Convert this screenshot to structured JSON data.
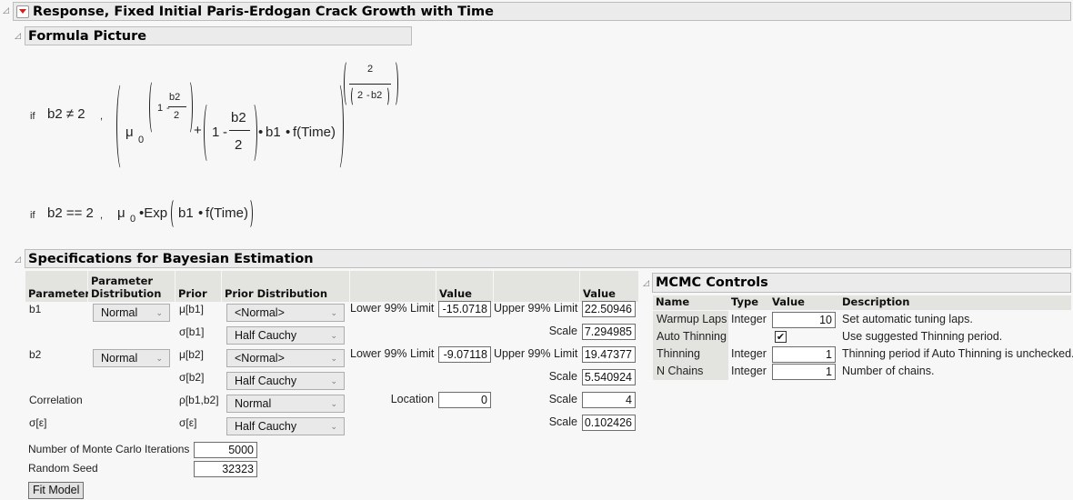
{
  "report": {
    "title": "Response, Fixed Initial Paris-Erdogan Crack Growth with Time",
    "menu_icon": "red-triangle-menu-icon",
    "disclosure_icon": "disclosure-triangle-icon"
  },
  "formula_picture": {
    "title": "Formula Picture",
    "case1": {
      "if": "if",
      "condition": "b2 ≠ 2",
      "comma": ",",
      "mu": "μ",
      "sub0": "0",
      "one": "1",
      "minus": "-",
      "b2": "b2",
      "two": "2",
      "plus": "+",
      "dot": "•",
      "b1": "b1",
      "f_time": "f(Time)",
      "exp_num": "2",
      "exp_den_a": "2",
      "exp_den_b": "b2"
    },
    "case2": {
      "if": "if",
      "condition": "b2 == 2",
      "comma": ",",
      "mu": "μ",
      "sub0": "0",
      "exp": "•Exp",
      "b1": "b1",
      "dot": "•",
      "f_time": "f(Time)"
    }
  },
  "specifications": {
    "title": "Specifications for Bayesian Estimation",
    "headers": {
      "parameter": "Parameter",
      "param_dist_1": "Parameter",
      "param_dist_2": "Distribution",
      "prior": "Prior",
      "prior_distribution": "Prior Distribution",
      "value1": "Value",
      "value2": "Value"
    },
    "rows": [
      {
        "parameter": "b1",
        "param_dist": "Normal",
        "prior": "μ[b1]",
        "prior_dist": "<Normal>",
        "label1": "Lower 99% Limit",
        "value1": "-15.0718",
        "label2": "Upper 99% Limit",
        "value2": "22.50946"
      },
      {
        "parameter": "",
        "param_dist": "",
        "prior": "σ[b1]",
        "prior_dist": "Half Cauchy",
        "label1": "",
        "value1": "",
        "label2": "Scale",
        "value2": "7.294985"
      },
      {
        "parameter": "b2",
        "param_dist": "Normal",
        "prior": "μ[b2]",
        "prior_dist": "<Normal>",
        "label1": "Lower 99% Limit",
        "value1": "-9.07118",
        "label2": "Upper 99% Limit",
        "value2": "19.47377"
      },
      {
        "parameter": "",
        "param_dist": "",
        "prior": "σ[b2]",
        "prior_dist": "Half Cauchy",
        "label1": "",
        "value1": "",
        "label2": "Scale",
        "value2": "5.540924"
      },
      {
        "parameter": "Correlation",
        "param_dist": "",
        "prior": "ρ[b1,b2]",
        "prior_dist": "Normal",
        "label1": "Location",
        "value1": "0",
        "label2": "Scale",
        "value2": "4"
      },
      {
        "parameter": "σ[ε]",
        "param_dist": "",
        "prior": "σ[ε]",
        "prior_dist": "Half Cauchy",
        "label1": "",
        "value1": "",
        "label2": "Scale",
        "value2": "0.102426"
      }
    ],
    "monte_carlo_label": "Number of Monte Carlo Iterations",
    "monte_carlo_value": "5000",
    "random_seed_label": "Random Seed",
    "random_seed_value": "32323",
    "fit_model_label": "Fit Model"
  },
  "mcmc": {
    "title": "MCMC Controls",
    "headers": {
      "name": "Name",
      "type": "Type",
      "value": "Value",
      "description": "Description"
    },
    "rows": [
      {
        "name": "Warmup Laps",
        "type": "Integer",
        "value": "10",
        "description": "Set automatic tuning laps."
      },
      {
        "name": "Auto Thinning",
        "type": "",
        "checked": true,
        "check_glyph": "✔",
        "description": "Use suggested Thinning period."
      },
      {
        "name": "Thinning",
        "type": "Integer",
        "value": "1",
        "description": "Thinning period if Auto Thinning is unchecked."
      },
      {
        "name": "N Chains",
        "type": "Integer",
        "value": "1",
        "description": "Number of chains."
      }
    ]
  }
}
